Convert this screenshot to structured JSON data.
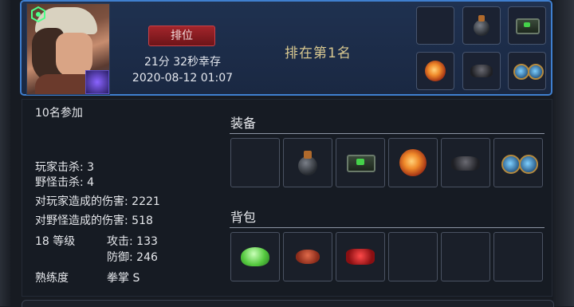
{
  "header": {
    "rank_badge": "排位",
    "score_time": "21分 32秒幸存",
    "date": "2020-08-12 01:07",
    "rank_result": "排在第1名"
  },
  "stats": {
    "participants": "10名参加",
    "player_kills": "玩家击杀: 3",
    "monster_kills": "野怪击杀: 4",
    "damage_to_players": "对玩家造成的伤害: 2221",
    "damage_to_monsters": "对野怪造成的伤害: 518",
    "level": "18 等级",
    "attack": "攻击: 133",
    "defense": "防御: 246",
    "mastery_label": "熟练度",
    "mastery_value": "拳掌 S"
  },
  "equipment": {
    "title": "装备",
    "slots": [
      "empty",
      "grenade-item",
      "chip-item",
      "fire-orb-item",
      "mech-crab-item",
      "goggles-item"
    ]
  },
  "backpack": {
    "title": "背包",
    "slots": [
      "green-crystal-item",
      "red-crab-item",
      "red-mech-item",
      "empty",
      "empty",
      "empty"
    ]
  },
  "colors": {
    "header_border": "#3f7fcf",
    "rank_badge": "#a3252b",
    "rank_text": "#d8c890"
  }
}
